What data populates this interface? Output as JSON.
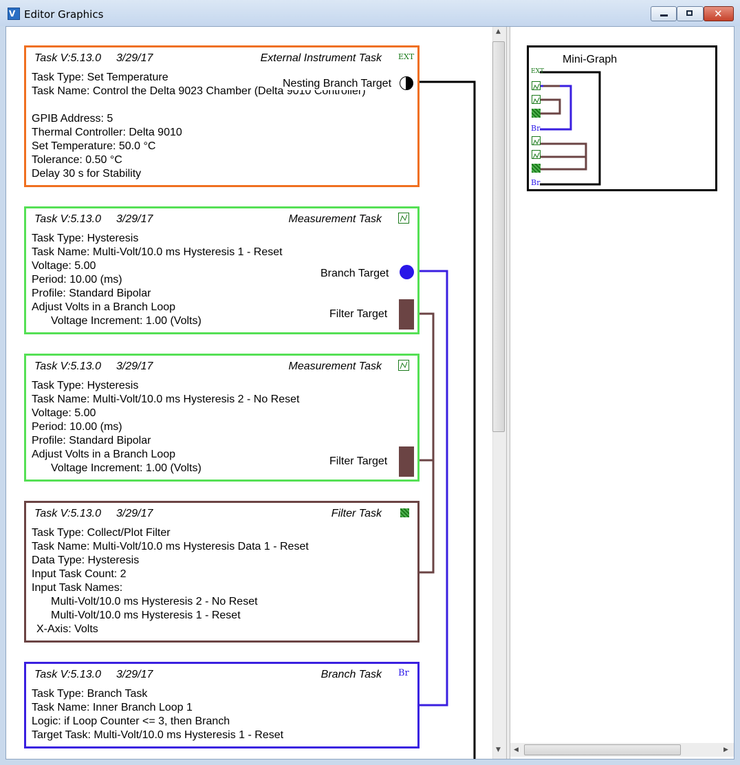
{
  "window": {
    "title": "Editor Graphics"
  },
  "tasks": [
    {
      "version": "Task V:5.13.0",
      "date": "3/29/17",
      "kind": "External Instrument Task",
      "icon": "external-instrument-icon",
      "icon_text": "EXT",
      "color": "#f07020",
      "lines": [
        {
          "text": "Task Type: Set Temperature"
        },
        {
          "text": "Task Name: Control the Delta 9023 Chamber (Delta 9010 Controller)"
        },
        {
          "text": ""
        },
        {
          "text": "GPIB Address: 5"
        },
        {
          "text": "Thermal Controller: Delta 9010"
        },
        {
          "text": "Set Temperature: 50.0 °C"
        },
        {
          "text": "Tolerance: 0.50  °C"
        },
        {
          "text": "Delay 30 s for Stability"
        }
      ],
      "targets": [
        {
          "label": "Nesting Branch Target"
        }
      ]
    },
    {
      "version": "Task V:5.13.0",
      "date": "3/29/17",
      "kind": "Measurement Task",
      "icon": "measurement-icon",
      "color": "#55e055",
      "lines": [
        {
          "text": "Task Type: Hysteresis"
        },
        {
          "text": "Task Name: Multi-Volt/10.0 ms Hysteresis 1 - Reset"
        },
        {
          "text": "Voltage: 5.00"
        },
        {
          "text": "Period: 10.00  (ms)"
        },
        {
          "text": "Profile: Standard Bipolar"
        },
        {
          "text": "Adjust Volts in a Branch Loop"
        },
        {
          "text": "Voltage Increment: 1.00   (Volts)"
        }
      ],
      "targets": [
        {
          "label": "Branch Target"
        },
        {
          "label": "Filter Target"
        }
      ]
    },
    {
      "version": "Task V:5.13.0",
      "date": "3/29/17",
      "kind": "Measurement Task",
      "icon": "measurement-icon",
      "color": "#55e055",
      "lines": [
        {
          "text": "Task Type: Hysteresis"
        },
        {
          "text": "Task Name: Multi-Volt/10.0 ms Hysteresis 2 - No Reset"
        },
        {
          "text": "Voltage: 5.00"
        },
        {
          "text": "Period: 10.00  (ms)"
        },
        {
          "text": "Profile: Standard Bipolar"
        },
        {
          "text": "Adjust Volts in a Branch Loop"
        },
        {
          "text": "Voltage Increment: 1.00   (Volts)"
        }
      ],
      "targets": [
        {
          "label": "Filter Target"
        }
      ]
    },
    {
      "version": "Task V:5.13.0",
      "date": "3/29/17",
      "kind": "Filter Task",
      "icon": "filter-icon",
      "color": "#6b4444",
      "lines": [
        {
          "text": "Task Type: Collect/Plot Filter"
        },
        {
          "text": "Task Name: Multi-Volt/10.0 ms Hysteresis Data 1 - Reset"
        },
        {
          "text": "Data Type: Hysteresis"
        },
        {
          "text": "Input Task Count: 2"
        },
        {
          "text": "Input Task Names:"
        },
        {
          "text": "Multi-Volt/10.0 ms Hysteresis 2 - No Reset"
        },
        {
          "text": "Multi-Volt/10.0 ms Hysteresis 1 - Reset"
        },
        {
          "text": "X-Axis: Volts"
        }
      ]
    },
    {
      "version": "Task V:5.13.0",
      "date": "3/29/17",
      "kind": "Branch Task",
      "icon": "branch-icon",
      "icon_text": "Br",
      "color": "#3a1fe0",
      "lines": [
        {
          "text": "Task Type: Branch Task"
        },
        {
          "text": "Task Name: Inner Branch Loop 1"
        },
        {
          "text": "Logic: if Loop Counter <= 3, then Branch"
        },
        {
          "text": "Target Task: Multi-Volt/10.0 ms Hysteresis 1 - Reset"
        }
      ]
    }
  ],
  "minigraph": {
    "title": "Mini-Graph",
    "items": [
      {
        "icon": "external-instrument-icon",
        "text": "EXT"
      },
      {
        "icon": "measurement-icon",
        "text": ""
      },
      {
        "icon": "measurement-icon",
        "text": ""
      },
      {
        "icon": "filter-icon",
        "text": ""
      },
      {
        "icon": "branch-icon",
        "text": "Br"
      },
      {
        "icon": "measurement-icon",
        "text": ""
      },
      {
        "icon": "measurement-icon",
        "text": ""
      },
      {
        "icon": "filter-icon",
        "text": ""
      },
      {
        "icon": "nesting-branch-icon",
        "text": "Br"
      }
    ]
  },
  "colors": {
    "external": "#f07020",
    "measurement": "#55e055",
    "filter": "#6b4444",
    "branch": "#3a1fe0",
    "nesting": "#000000"
  }
}
